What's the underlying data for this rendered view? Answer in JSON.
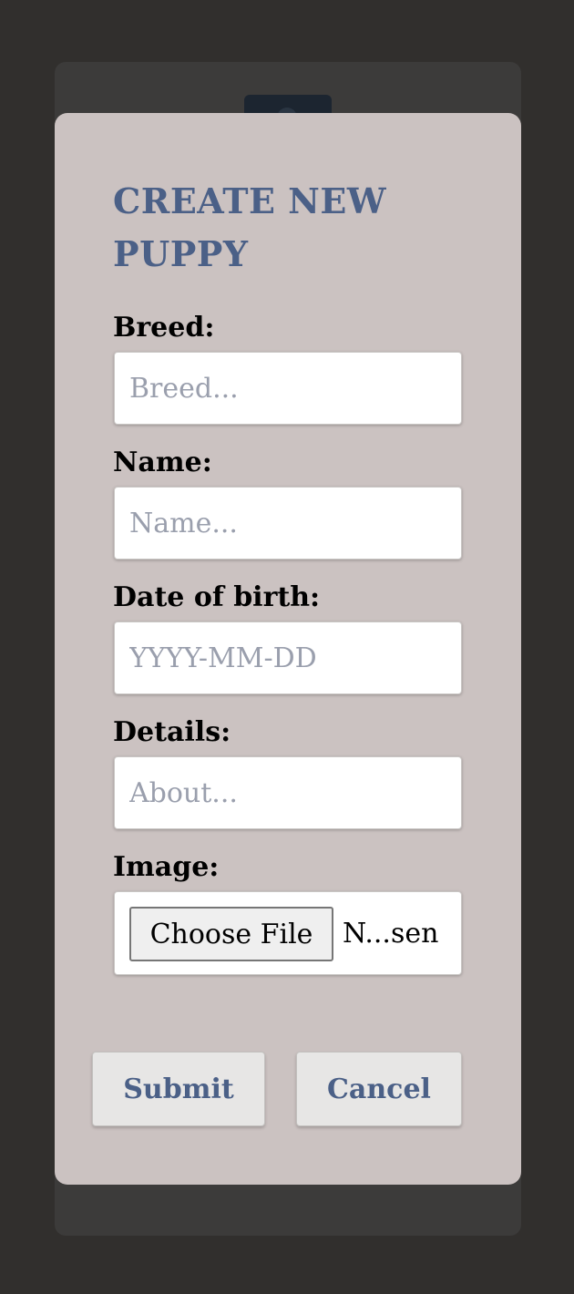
{
  "modal": {
    "title": "CREATE NEW PUPPY",
    "fields": {
      "breed": {
        "label": "Breed:",
        "placeholder": "Breed...",
        "value": ""
      },
      "name": {
        "label": "Name:",
        "placeholder": "Name...",
        "value": ""
      },
      "dob": {
        "label": "Date of birth:",
        "placeholder": "YYYY-MM-DD",
        "value": ""
      },
      "details": {
        "label": "Details:",
        "placeholder": "About...",
        "value": ""
      },
      "image": {
        "label": "Image:",
        "button_label": "Choose File",
        "status": "N...sen"
      }
    },
    "actions": {
      "submit": "Submit",
      "cancel": "Cancel"
    }
  },
  "background": {
    "icons": [
      "pencil-icon",
      "trash-icon"
    ]
  },
  "colors": {
    "page_bg": "#312f2d",
    "modal_bg": "#cbc2c1",
    "accent": "#4b6087",
    "button_bg": "#e7e6e5"
  }
}
